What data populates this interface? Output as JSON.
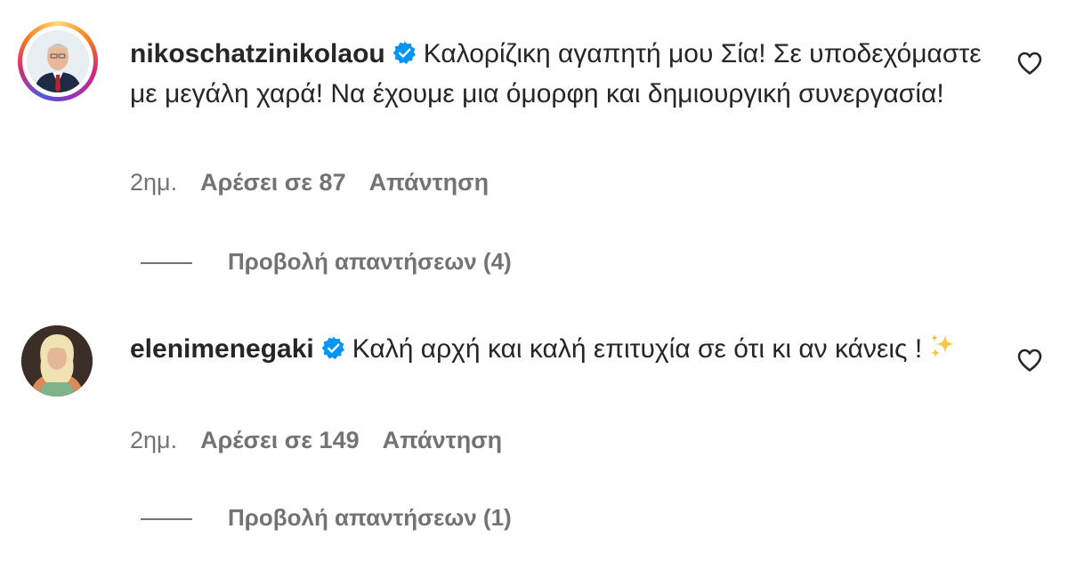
{
  "comments": [
    {
      "username": "nikoschatzinikolaou",
      "verified": true,
      "text": "Καλορίζικη αγαπητή μου Σία! Σε υποδεχόμαστε με μεγάλη χαρά! Να έχουμε μια όμορφη και δημιουργική συνεργασία!",
      "time": "2ημ.",
      "likes": "Αρέσει σε 87",
      "reply_label": "Απάντηση",
      "view_replies": "Προβολή απαντήσεων (4)",
      "avatar_ring": true
    },
    {
      "username": "elenimenegaki",
      "verified": true,
      "text": "Καλή αρχή και καλή επιτυχία σε ότι κι αν κάνεις !",
      "emoji": "sparkles",
      "time": "2ημ.",
      "likes": "Αρέσει σε 149",
      "reply_label": "Απάντηση",
      "view_replies": "Προβολή απαντήσεων (1)",
      "avatar_ring": false
    }
  ],
  "colors": {
    "text": "#262626",
    "secondary": "#737373",
    "verified": "#0095f6"
  },
  "icons": {
    "like": "heart-outline-icon",
    "verified": "verified-badge-icon"
  }
}
